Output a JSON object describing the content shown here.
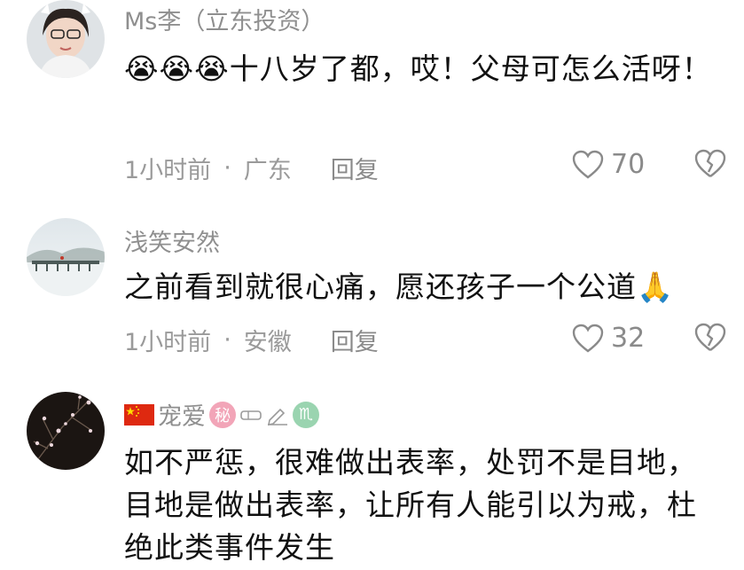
{
  "comments": [
    {
      "name": "Ms李（立东投资）",
      "emoji": "😭😭😭",
      "text": "十八岁了都，哎！父母可怎么活呀！",
      "time": "1小时前",
      "dot": "·",
      "location": "广东",
      "reply": "回复",
      "likes": "70"
    },
    {
      "name": "浅笑安然",
      "text": "之前看到就很心痛，愿还孩子一个公道",
      "emoji": "🙏",
      "time": "1小时前",
      "dot": "·",
      "location": "安徽",
      "reply": "回复",
      "likes": "32"
    },
    {
      "name": "宠爱",
      "badges": [
        "秘",
        "♏"
      ],
      "text": "如不严惩，很难做出表率，处罚不是目地，目地是做出表率，让所有人能引以为戒，杜绝此类事件发生"
    }
  ],
  "colors": {
    "secondary": "#8f8f8f",
    "flag": "#de2910",
    "badge_pink": "#f2a5b8",
    "badge_green": "#9ad4b0"
  },
  "icons": [
    "heart-outline-icon",
    "broken-heart-icon",
    "china-flag-icon",
    "pencil-icon",
    "eraser-icon"
  ]
}
